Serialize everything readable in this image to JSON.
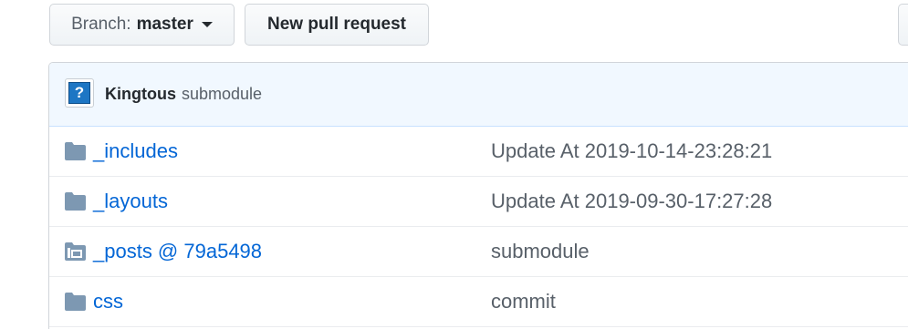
{
  "toolbar": {
    "branch_prefix": "Branch:",
    "branch_name": "master",
    "new_pull_request_label": "New pull request"
  },
  "latest_commit": {
    "avatar_glyph": "?",
    "author": "Kingtous",
    "message": "submodule"
  },
  "files": [
    {
      "name": "_includes",
      "type": "folder",
      "icon": "folder-icon",
      "commit_message": "Update At 2019-10-14-23:28:21"
    },
    {
      "name": "_layouts",
      "type": "folder",
      "icon": "folder-icon",
      "commit_message": "Update At 2019-09-30-17:27:28"
    },
    {
      "name": "_posts @ 79a5498",
      "type": "submodule",
      "icon": "submodule-icon",
      "commit_message": "submodule"
    },
    {
      "name": "css",
      "type": "folder",
      "icon": "folder-icon",
      "commit_message": "commit"
    }
  ],
  "colors": {
    "link": "#0366d6",
    "folder_icon": "#79b8ff",
    "commit_bar_bg": "#f1f8ff"
  }
}
